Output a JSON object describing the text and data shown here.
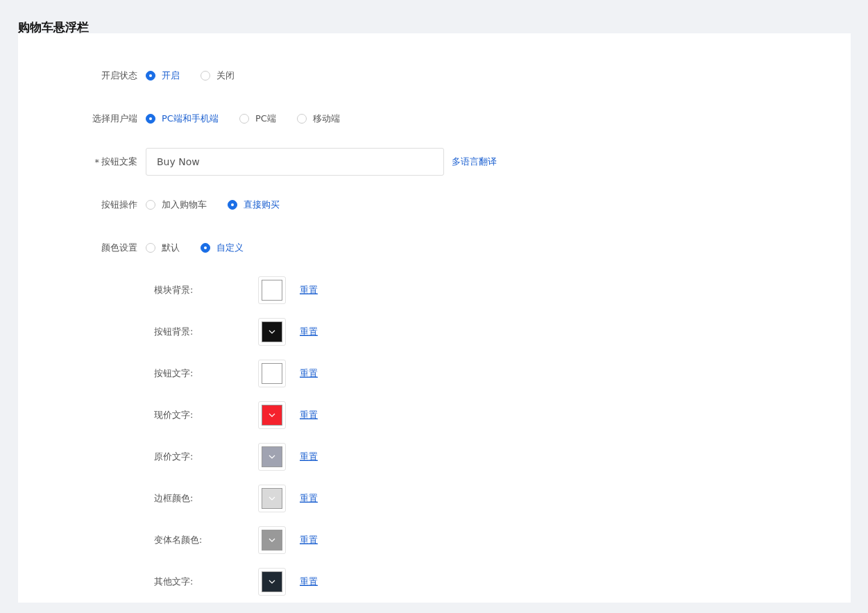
{
  "page_title": "购物车悬浮栏",
  "form": [
    {
      "kind": "radio",
      "label": "开启状态",
      "options": [
        {
          "label": "开启",
          "selected": true
        },
        {
          "label": "关闭",
          "selected": false
        }
      ]
    },
    {
      "kind": "radio",
      "label": "选择用户端",
      "options": [
        {
          "label": "PC端和手机端",
          "selected": true
        },
        {
          "label": "PC端",
          "selected": false
        },
        {
          "label": "移动端",
          "selected": false
        }
      ]
    },
    {
      "kind": "input",
      "required_mark": "*",
      "label": "按钮文案",
      "value": "Buy Now",
      "link": "多语言翻译"
    },
    {
      "kind": "radio",
      "label": "按钮操作",
      "options": [
        {
          "label": "加入购物车",
          "selected": false
        },
        {
          "label": "直接购买",
          "selected": true
        }
      ]
    },
    {
      "kind": "radio",
      "label": "颜色设置",
      "options": [
        {
          "label": "默认",
          "selected": false
        },
        {
          "label": "自定义",
          "selected": true
        }
      ]
    }
  ],
  "colors": [
    {
      "label": "模块背景:",
      "color": "#ffffff",
      "reset": "重置"
    },
    {
      "label": "按钮背景:",
      "color": "#111111",
      "reset": "重置"
    },
    {
      "label": "按钮文字:",
      "color": "#ffffff",
      "reset": "重置"
    },
    {
      "label": "现价文字:",
      "color": "#f5222d",
      "reset": "重置"
    },
    {
      "label": "原价文字:",
      "color": "#a0a3b1",
      "reset": "重置"
    },
    {
      "label": "边框颜色:",
      "color": "#d9d9d9",
      "reset": "重置"
    },
    {
      "label": "变体名颜色:",
      "color": "#999999",
      "reset": "重置"
    },
    {
      "label": "其他文字:",
      "color": "#1f2933",
      "reset": "重置"
    }
  ]
}
